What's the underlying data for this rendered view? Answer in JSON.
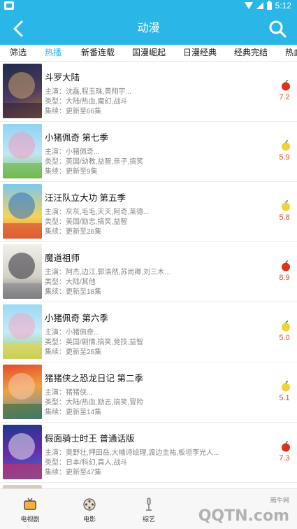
{
  "status_bar": {
    "time": "5:12"
  },
  "header": {
    "title": "动漫",
    "back_icon": "chevron-left-icon",
    "search_icon": "search-icon"
  },
  "tabs": [
    {
      "label": "筛选",
      "active": false
    },
    {
      "label": "热播",
      "active": true
    },
    {
      "label": "新番连载",
      "active": false
    },
    {
      "label": "国漫崛起",
      "active": false
    },
    {
      "label": "日漫经典",
      "active": false
    },
    {
      "label": "经典完结",
      "active": false
    },
    {
      "label": "热血",
      "active": false
    }
  ],
  "items": [
    {
      "title": "斗罗大陆",
      "cast": "主演：沈磊,程玉珠,黄翔宇...",
      "genre": "类型：大陆/热血,魔幻,战斗",
      "episodes": "集续：更新至66集",
      "rating": "7.2",
      "fruit": "red-apple-icon"
    },
    {
      "title": "小猪佩奇 第七季",
      "cast": "主演：小猪佩奇...",
      "genre": "类型：英国/幼教,益智,亲子,搞笑",
      "episodes": "集续：更新至9集",
      "rating": "5.9",
      "fruit": "green-apple-icon"
    },
    {
      "title": "汪汪队立大功 第五季",
      "cast": "主演：灰灰,毛毛,天天,阿奇,莱德...",
      "genre": "类型：美国/励志,搞笑,益智",
      "episodes": "集续：更新至26集",
      "rating": "5.8",
      "fruit": "green-apple-icon"
    },
    {
      "title": "魔道祖师",
      "cast": "主演：阿杰,边江,郭浩然,苏尚卿,刘三木...",
      "genre": "类型：大陆/其他",
      "episodes": "集续：更新至18集",
      "rating": "8.9",
      "fruit": "red-apple-icon"
    },
    {
      "title": "小猪佩奇 第六季",
      "cast": "主演：小猪佩奇...",
      "genre": "类型：英国/剧情,搞笑,竞技,益智",
      "episodes": "集续：更新至26集",
      "rating": "5.0",
      "fruit": "green-apple-icon"
    },
    {
      "title": "猪猪侠之恐龙日记 第二季",
      "cast": "主演：猪猪侠...",
      "genre": "类型：大陆/热血,励志,搞笑,冒险",
      "episodes": "集续：更新至14集",
      "rating": "5.1",
      "fruit": "green-apple-icon"
    },
    {
      "title": "假面骑士时王 普通话版",
      "cast": "主演：奥野壮,押田岳,大幡诗绘理,渡边圭祐,板垣李光人...",
      "genre": "类型：日本/科幻,真人,战斗",
      "episodes": "集续：更新至47集",
      "rating": "7.3",
      "fruit": "red-apple-icon"
    }
  ],
  "bottom_nav": [
    {
      "label": "电视剧",
      "icon": "tv-icon"
    },
    {
      "label": "电影",
      "icon": "film-reel-icon"
    },
    {
      "label": "综艺",
      "icon": "microphone-icon"
    }
  ],
  "watermark": {
    "text": "QQTN.com",
    "sub": "腾牛网"
  },
  "colors": {
    "accent": "#2bb6e8",
    "rating": "#e0491e",
    "apple_red": "#e0301e",
    "apple_green": "#f0d23a"
  }
}
